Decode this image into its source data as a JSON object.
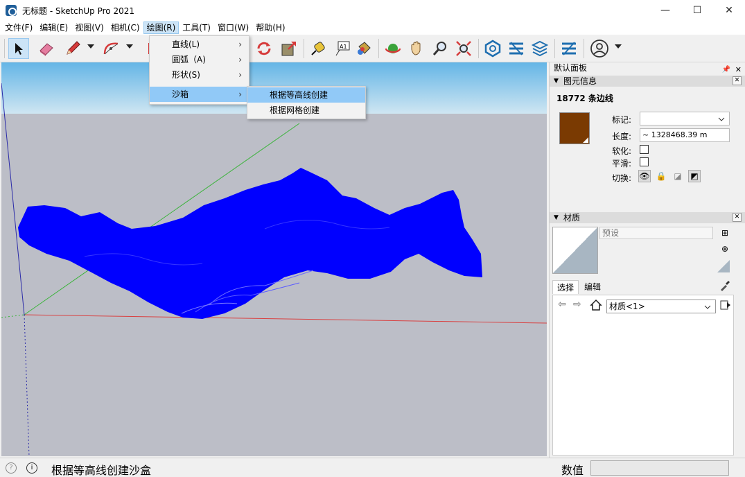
{
  "window": {
    "title": "无标题 - SketchUp Pro 2021",
    "minimize": "—",
    "maximize": "☐",
    "close": "✕"
  },
  "menubar": [
    {
      "label": "文件(F)"
    },
    {
      "label": "编辑(E)"
    },
    {
      "label": "视图(V)"
    },
    {
      "label": "相机(C)"
    },
    {
      "label": "绘图(R)",
      "active": true
    },
    {
      "label": "工具(T)"
    },
    {
      "label": "窗口(W)"
    },
    {
      "label": "帮助(H)"
    }
  ],
  "draw_menu": {
    "items": [
      {
        "label": "直线(L)",
        "submenu": true
      },
      {
        "label": "圆弧（A)",
        "submenu": true
      },
      {
        "label": "形状(S)",
        "submenu": true
      },
      {
        "label": "沙箱",
        "submenu": true,
        "highlighted": true
      }
    ]
  },
  "sandbox_submenu": {
    "items": [
      {
        "label": "根据等高线创建",
        "highlighted": true
      },
      {
        "label": "根据网格创建"
      }
    ]
  },
  "panel": {
    "title": "默认面板",
    "entity_info": {
      "header": "图元信息",
      "count": "18772 条边线",
      "swatch_color": "#7a3a02",
      "tag_label": "标记:",
      "tag_value": "",
      "length_label": "长度:",
      "length_value": "~ 1328468.39 m",
      "soften_label": "软化:",
      "smooth_label": "平滑:",
      "toggle_label": "切换:"
    },
    "materials": {
      "header": "材质",
      "name_placeholder": "预设",
      "tab_select": "选择",
      "tab_edit": "编辑",
      "collection": "材质<1>"
    }
  },
  "status": {
    "text": "根据等高线创建沙盒",
    "measure_label": "数值",
    "measure_value": ""
  },
  "colors": {
    "terrain": "#0000ff",
    "axis_red": "#d94040",
    "axis_green": "#3cb33c",
    "sky_top": "#64b5e6",
    "ground": "#bcbec7",
    "menu_highlight": "#91c9f7"
  }
}
